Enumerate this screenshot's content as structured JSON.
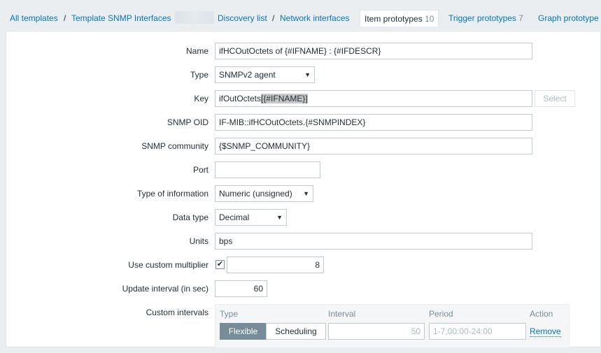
{
  "nav": {
    "breadcrumb_all": "All templates",
    "breadcrumb_sep": "/",
    "breadcrumb_template": "Template SNMP Interfaces",
    "discovery_list": "Discovery list",
    "network_interfaces": "Network interfaces",
    "tabs": [
      {
        "label": "Item prototypes",
        "count": "10",
        "active": true
      },
      {
        "label": "Trigger prototypes",
        "count": "7",
        "active": false
      },
      {
        "label": "Graph prototype",
        "count": "",
        "active": false
      }
    ]
  },
  "form": {
    "name_label": "Name",
    "name_value": "ifHCOutOctets of {#IFNAME} : {#IFDESCR}",
    "type_label": "Type",
    "type_value": "SNMPv2 agent",
    "key_label": "Key",
    "key_value_prefix": "ifOutOctets",
    "key_value_selected": "[{#IFNAME}]",
    "key_select_button": "Select",
    "snmp_oid_label": "SNMP OID",
    "snmp_oid_value": "IF-MIB::ifHCOutOctets.{#SNMPINDEX}",
    "snmp_community_label": "SNMP community",
    "snmp_community_value": "{$SNMP_COMMUNITY}",
    "port_label": "Port",
    "port_value": "",
    "type_info_label": "Type of information",
    "type_info_value": "Numeric (unsigned)",
    "data_type_label": "Data type",
    "data_type_value": "Decimal",
    "units_label": "Units",
    "units_value": "bps",
    "multiplier_label": "Use custom multiplier",
    "multiplier_checked": true,
    "multiplier_value": "8",
    "interval_label": "Update interval (in sec)",
    "interval_value": "60",
    "custom_intervals_label": "Custom intervals",
    "custom_intervals": {
      "headers": {
        "type": "Type",
        "interval": "Interval",
        "period": "Period",
        "action": "Action"
      },
      "row": {
        "type_flexible": "Flexible",
        "type_scheduling": "Scheduling",
        "interval_placeholder": "50",
        "period_placeholder": "1-7,00:00-24:00",
        "action": "Remove"
      }
    }
  },
  "icons": {
    "dropdown_arrow": "▼",
    "checkmark": "✔"
  },
  "colors": {
    "link": "#0275b8",
    "segment_active": "#768d99",
    "background": "#ebeef0"
  }
}
